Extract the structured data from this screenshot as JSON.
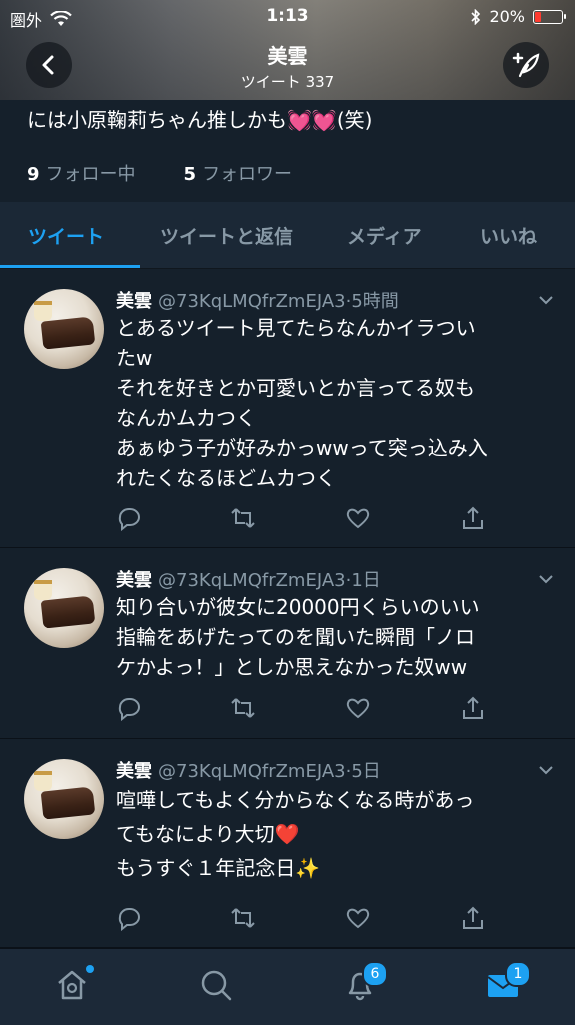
{
  "status_bar": {
    "carrier": "圏外",
    "time": "1:13",
    "battery": "20%",
    "battery_level": 0.2,
    "icons": [
      "wifi-icon",
      "bluetooth-icon",
      "battery-icon"
    ]
  },
  "nav": {
    "title": "美雲",
    "subtitle": "ツイート 337",
    "back_icon": "chevron-left-icon",
    "compose_icon": "compose-feather-icon"
  },
  "profile": {
    "bio_line": "には小原鞠莉ちゃん推しかも",
    "bio_emoji": "💓💓",
    "bio_suffix": "(笑)",
    "following_count": "9",
    "following_label": "フォロー中",
    "followers_count": "5",
    "followers_label": "フォロワー"
  },
  "tabs": [
    {
      "label": "ツイート",
      "active": true
    },
    {
      "label": "ツイートと返信",
      "active": false
    },
    {
      "label": "メディア",
      "active": false
    },
    {
      "label": "いいね",
      "active": false
    }
  ],
  "tweets": [
    {
      "name": "美雲",
      "handle": "@73KqLMQfrZmEJA3",
      "time": "5時間",
      "lines": [
        "とあるツイート見てたらなんかイラつい",
        "たw",
        "それを好きとか可愛いとか言ってる奴も",
        "なんかムカつく",
        "あぁゆう子が好みかっwwって突っ込み入",
        "れたくなるほどムカつく"
      ]
    },
    {
      "name": "美雲",
      "handle": "@73KqLMQfrZmEJA3",
      "time": "1日",
      "lines": [
        "知り合いが彼女に20000円くらいのいい",
        "指輪をあげたってのを聞いた瞬間「ノロ",
        "ケかよっ！」としか思えなかった奴ww"
      ]
    },
    {
      "name": "美雲",
      "handle": "@73KqLMQfrZmEJA3",
      "time": "5日",
      "lines": [
        "喧嘩してもよく分からなくなる時があっ",
        "てもなにより大切❤️",
        "もうすぐ１年記念日✨"
      ]
    }
  ],
  "bottom_nav": {
    "items": [
      "home-icon",
      "search-icon",
      "notifications-icon",
      "messages-icon"
    ],
    "notifications_badge": "6",
    "messages_badge": "1"
  },
  "colors": {
    "background": "#15202b",
    "accent": "#1da1f2",
    "muted": "#8899a6",
    "battery_low": "#ff3b30"
  }
}
